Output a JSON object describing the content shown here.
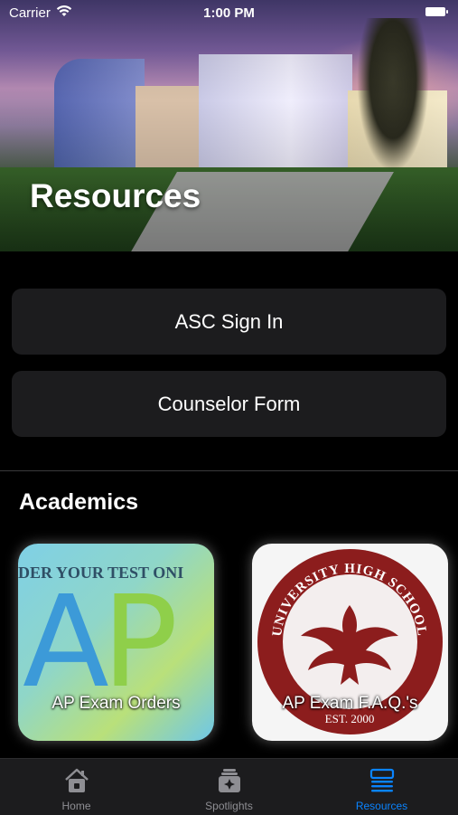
{
  "status_bar": {
    "carrier": "Carrier",
    "time": "1:00 PM"
  },
  "hero": {
    "title": "Resources"
  },
  "buttons": {
    "asc_sign_in": "ASC Sign In",
    "counselor_form": "Counselor Form"
  },
  "academics": {
    "title": "Academics",
    "cards": [
      {
        "label": "AP Exam Orders",
        "banner_text": "DER YOUR TEST ONI",
        "logo_a": "A",
        "logo_p": "P"
      },
      {
        "label": "AP Exam F.A.Q.'s",
        "seal_text": "UNIVERSITY HIGH SCHOOL",
        "seal_est": "EST. 2000"
      }
    ]
  },
  "tab_bar": {
    "active_color": "#0a84ff",
    "inactive_color": "#8e8e93",
    "tabs": [
      {
        "label": "Home",
        "icon": "home-icon",
        "active": false
      },
      {
        "label": "Spotlights",
        "icon": "spotlights-icon",
        "active": false
      },
      {
        "label": "Resources",
        "icon": "resources-icon",
        "active": true
      }
    ]
  }
}
